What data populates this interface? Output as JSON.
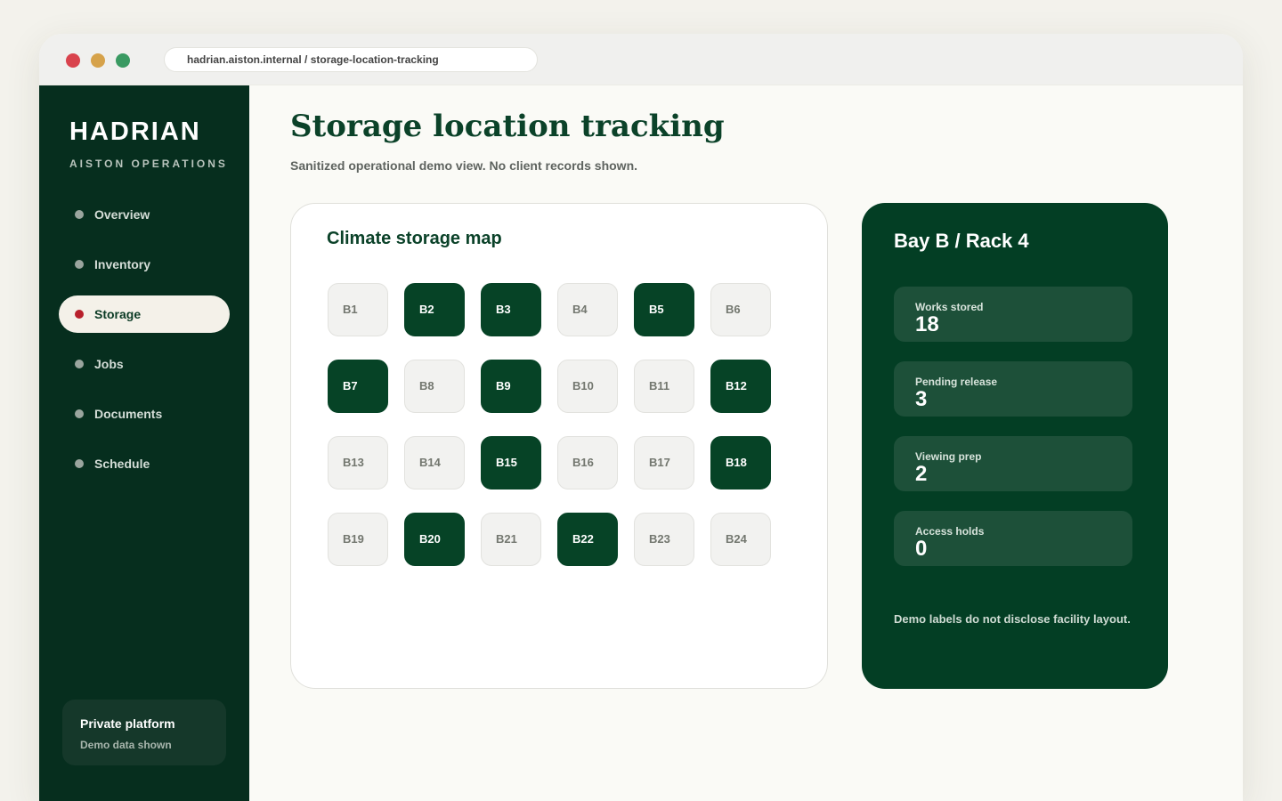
{
  "browser": {
    "url": "hadrian.aiston.internal / storage-location-tracking"
  },
  "sidebar": {
    "brand": "HADRIAN",
    "brand_sub": "AISTON OPERATIONS",
    "items": [
      {
        "label": "Overview",
        "active": false
      },
      {
        "label": "Inventory",
        "active": false
      },
      {
        "label": "Storage",
        "active": true
      },
      {
        "label": "Jobs",
        "active": false
      },
      {
        "label": "Documents",
        "active": false
      },
      {
        "label": "Schedule",
        "active": false
      }
    ],
    "footer": {
      "title": "Private platform",
      "subtitle": "Demo data shown"
    }
  },
  "main": {
    "title": "Storage location tracking",
    "subtitle": "Sanitized operational demo view. No client records shown.",
    "map": {
      "title": "Climate storage map",
      "slots": [
        {
          "label": "B1",
          "occupied": false
        },
        {
          "label": "B2",
          "occupied": true
        },
        {
          "label": "B3",
          "occupied": true
        },
        {
          "label": "B4",
          "occupied": false
        },
        {
          "label": "B5",
          "occupied": true
        },
        {
          "label": "B6",
          "occupied": false
        },
        {
          "label": "B7",
          "occupied": true
        },
        {
          "label": "B8",
          "occupied": false
        },
        {
          "label": "B9",
          "occupied": true
        },
        {
          "label": "B10",
          "occupied": false
        },
        {
          "label": "B11",
          "occupied": false
        },
        {
          "label": "B12",
          "occupied": true
        },
        {
          "label": "B13",
          "occupied": false
        },
        {
          "label": "B14",
          "occupied": false
        },
        {
          "label": "B15",
          "occupied": true
        },
        {
          "label": "B16",
          "occupied": false
        },
        {
          "label": "B17",
          "occupied": false
        },
        {
          "label": "B18",
          "occupied": true
        },
        {
          "label": "B19",
          "occupied": false
        },
        {
          "label": "B20",
          "occupied": true
        },
        {
          "label": "B21",
          "occupied": false
        },
        {
          "label": "B22",
          "occupied": true
        },
        {
          "label": "B23",
          "occupied": false
        },
        {
          "label": "B24",
          "occupied": false
        }
      ]
    },
    "detail": {
      "title": "Bay B / Rack 4",
      "stats": [
        {
          "label": "Works stored",
          "value": "18"
        },
        {
          "label": "Pending release",
          "value": "3"
        },
        {
          "label": "Viewing prep",
          "value": "2"
        },
        {
          "label": "Access holds",
          "value": "0"
        }
      ],
      "note": "Demo labels do not disclose facility layout."
    }
  },
  "colors": {
    "brand_dark": "#062e1e",
    "panel_green": "#033e24",
    "occupied": "#064326",
    "active_bullet": "#b8202c"
  }
}
